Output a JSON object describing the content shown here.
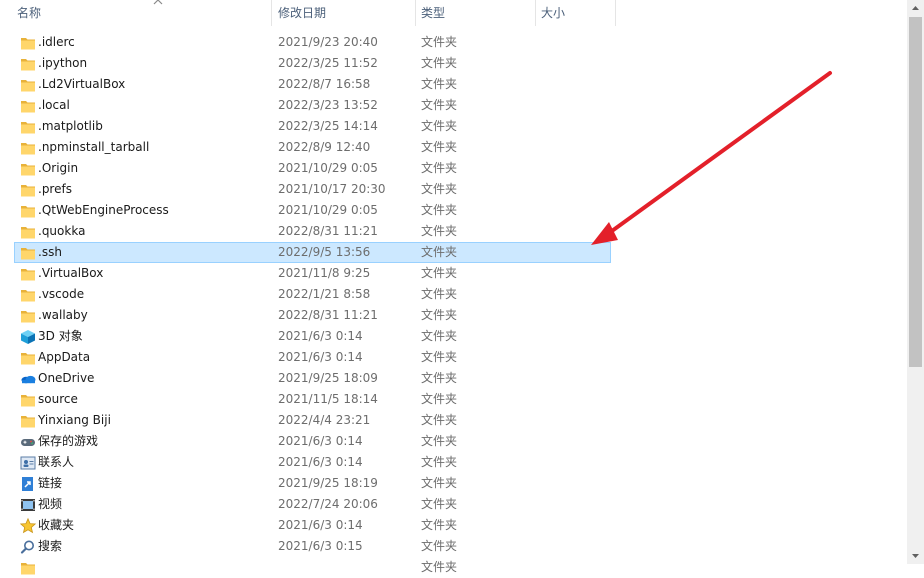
{
  "columns": {
    "name": "名称",
    "date": "修改日期",
    "type": "类型",
    "size": "大小"
  },
  "files": [
    {
      "name": ".idlerc",
      "date": "2021/9/23 20:40",
      "type": "文件夹",
      "icon": "folder-icon"
    },
    {
      "name": ".ipython",
      "date": "2022/3/25 11:52",
      "type": "文件夹",
      "icon": "folder-icon"
    },
    {
      "name": ".Ld2VirtualBox",
      "date": "2022/8/7 16:58",
      "type": "文件夹",
      "icon": "folder-icon"
    },
    {
      "name": ".local",
      "date": "2022/3/23 13:52",
      "type": "文件夹",
      "icon": "folder-icon"
    },
    {
      "name": ".matplotlib",
      "date": "2022/3/25 14:14",
      "type": "文件夹",
      "icon": "folder-icon"
    },
    {
      "name": ".npminstall_tarball",
      "date": "2022/8/9 12:40",
      "type": "文件夹",
      "icon": "folder-icon"
    },
    {
      "name": ".Origin",
      "date": "2021/10/29 0:05",
      "type": "文件夹",
      "icon": "folder-icon"
    },
    {
      "name": ".prefs",
      "date": "2021/10/17 20:30",
      "type": "文件夹",
      "icon": "folder-icon"
    },
    {
      "name": ".QtWebEngineProcess",
      "date": "2021/10/29 0:05",
      "type": "文件夹",
      "icon": "folder-icon"
    },
    {
      "name": ".quokka",
      "date": "2022/8/31 11:21",
      "type": "文件夹",
      "icon": "folder-icon"
    },
    {
      "name": ".ssh",
      "date": "2022/9/5 13:56",
      "type": "文件夹",
      "icon": "folder-icon",
      "selected": true
    },
    {
      "name": ".VirtualBox",
      "date": "2021/11/8 9:25",
      "type": "文件夹",
      "icon": "folder-icon"
    },
    {
      "name": ".vscode",
      "date": "2022/1/21 8:58",
      "type": "文件夹",
      "icon": "folder-icon"
    },
    {
      "name": ".wallaby",
      "date": "2022/8/31 11:21",
      "type": "文件夹",
      "icon": "folder-icon"
    },
    {
      "name": "3D 对象",
      "date": "2021/6/3 0:14",
      "type": "文件夹",
      "icon": "3d-objects-icon"
    },
    {
      "name": "AppData",
      "date": "2021/6/3 0:14",
      "type": "文件夹",
      "icon": "folder-icon"
    },
    {
      "name": "OneDrive",
      "date": "2021/9/25 18:09",
      "type": "文件夹",
      "icon": "onedrive-icon"
    },
    {
      "name": "source",
      "date": "2021/11/5 18:14",
      "type": "文件夹",
      "icon": "folder-icon"
    },
    {
      "name": "Yinxiang Biji",
      "date": "2022/4/4 23:21",
      "type": "文件夹",
      "icon": "folder-icon"
    },
    {
      "name": "保存的游戏",
      "date": "2021/6/3 0:14",
      "type": "文件夹",
      "icon": "saved-games-icon"
    },
    {
      "name": "联系人",
      "date": "2021/6/3 0:14",
      "type": "文件夹",
      "icon": "contacts-icon"
    },
    {
      "name": "链接",
      "date": "2021/9/25 18:19",
      "type": "文件夹",
      "icon": "links-icon"
    },
    {
      "name": "视频",
      "date": "2022/7/24 20:06",
      "type": "文件夹",
      "icon": "videos-icon"
    },
    {
      "name": "收藏夹",
      "date": "2021/6/3 0:14",
      "type": "文件夹",
      "icon": "favorites-icon"
    },
    {
      "name": "搜索",
      "date": "2021/6/3 0:15",
      "type": "文件夹",
      "icon": "searches-icon"
    },
    {
      "name": "",
      "date": "",
      "type": "文件夹",
      "icon": "folder-icon"
    }
  ],
  "annotation": {
    "arrow_color": "#e3202a"
  },
  "colors": {
    "selection_bg": "#cce8ff",
    "selection_border": "#99d1ff",
    "folder": "#ffd66b"
  }
}
